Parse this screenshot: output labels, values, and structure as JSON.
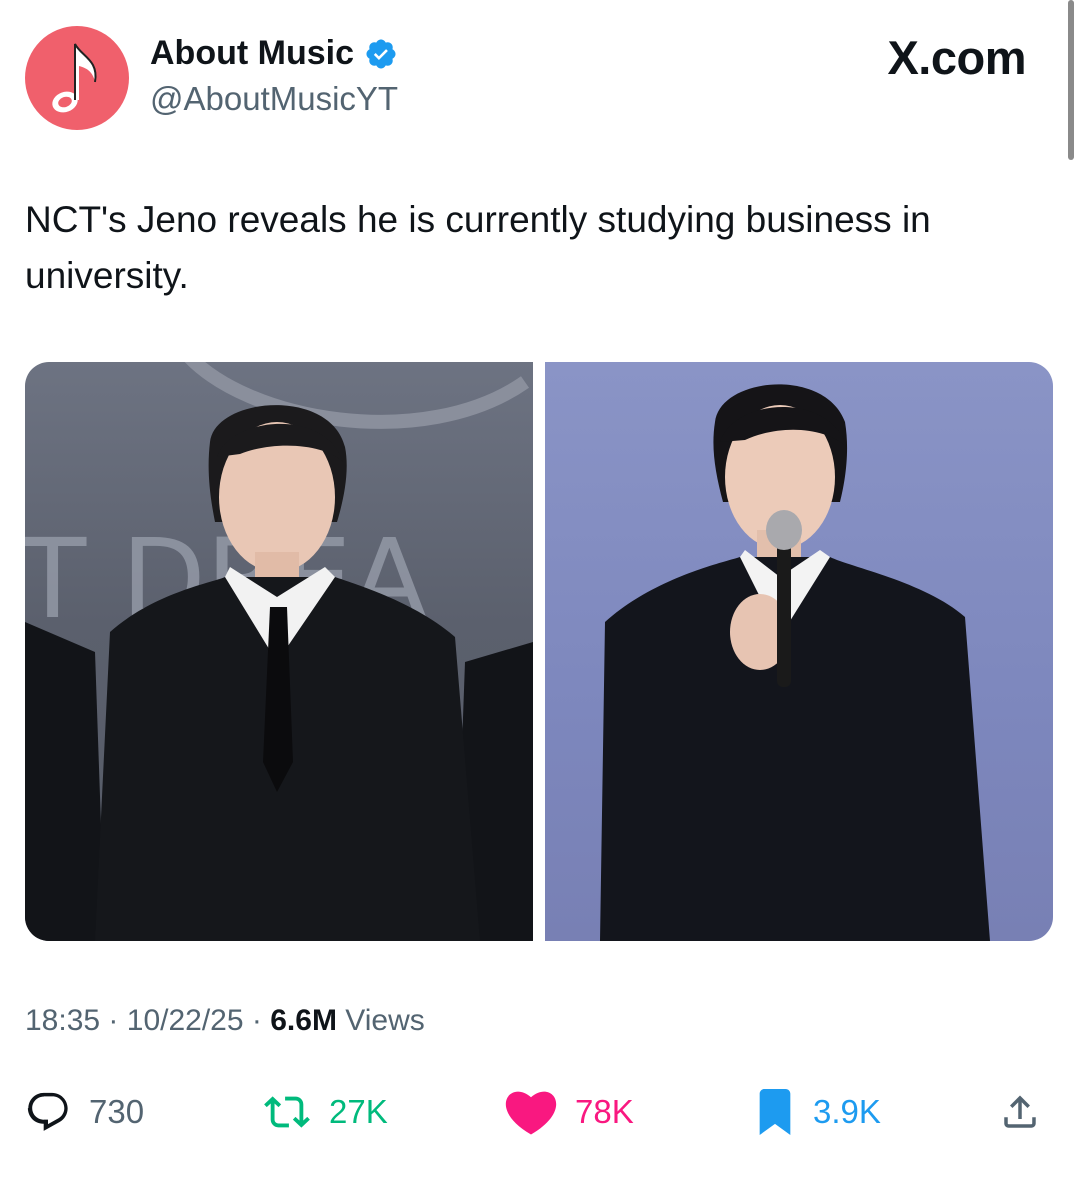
{
  "header": {
    "display_name": "About Music",
    "handle": "@AboutMusicYT",
    "brand": "X.com",
    "avatar_icon": "music-note-icon",
    "verified_icon": "verified-badge-icon",
    "colors": {
      "avatar_bg": "#f0606c",
      "verified": "#1d9bf0"
    }
  },
  "tweet": {
    "text": "NCT's Jeno reveals he is currently studying business in university.",
    "images": [
      {
        "description_icon": "photo-left"
      },
      {
        "description_icon": "photo-right"
      }
    ]
  },
  "meta": {
    "time": "18:35",
    "date": "10/22/25",
    "views_count": "6.6M",
    "views_label": "Views",
    "separator": "·"
  },
  "actions": {
    "reply": {
      "icon": "reply-icon",
      "count": "730",
      "color": "#536471"
    },
    "retweet": {
      "icon": "retweet-icon",
      "count": "27K",
      "color": "#00ba7c"
    },
    "like": {
      "icon": "heart-icon",
      "count": "78K",
      "color": "#f91880"
    },
    "bookmark": {
      "icon": "bookmark-icon",
      "count": "3.9K",
      "color": "#1d9bf0"
    },
    "share": {
      "icon": "share-icon"
    }
  }
}
